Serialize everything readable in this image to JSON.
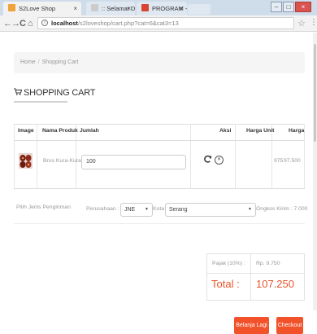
{
  "browser": {
    "tabs": [
      {
        "title": "S2Love Shop",
        "icon_color": "#f0a33a"
      },
      {
        "title": ":: Selamat Datang Di R...",
        "icon_color": "#cccccc"
      },
      {
        "title": "PROGRAM - shiemyal@...",
        "icon_color": "#d64532"
      }
    ],
    "tab_close": "×",
    "window_buttons": {
      "minimize": "–",
      "maximize": "□",
      "close": "×"
    },
    "nav": {
      "back": "←",
      "forward": "→",
      "reload": "C",
      "home": "⌂"
    },
    "address": {
      "info_icon": "i",
      "host": "localhost",
      "path": "/s2loveshop/cart.php?cat=6&cat3=13"
    },
    "star": "☆",
    "menu": "⋮"
  },
  "breadcrumb": {
    "home": "Home",
    "separator": "/",
    "current": "Shopping Cart"
  },
  "page_title": {
    "icon": "🛒",
    "text": "SHOPPING CART"
  },
  "table": {
    "headers": {
      "image": "Image",
      "name": "Nama Produk",
      "qty": "Jumlah",
      "action": "Aksi",
      "unit_price": "Harga Unit",
      "price": "Harga"
    },
    "rows": [
      {
        "name": "Bros Kura-Kura",
        "qty": "100",
        "unit_price": "975",
        "price": "97.500"
      }
    ]
  },
  "shipping": {
    "label": "Pilih Jenis Pengiriman",
    "company_label": "Perusahaan :",
    "company_value": "JNE",
    "city_label": "Kota :",
    "city_value": "Serang",
    "cost_text": "Ongkos Kirim : 7.000",
    "caret": "▼"
  },
  "summary": {
    "tax_label": "Pajak (10%) :",
    "tax_value": "Rp. 9.750",
    "total_label": "Total :",
    "total_value": "107.250"
  },
  "buttons": {
    "continue": "Belanja Lagi",
    "checkout": "Checkout"
  },
  "colors": {
    "accent": "#f2522a",
    "total_text": "#e8532b"
  }
}
